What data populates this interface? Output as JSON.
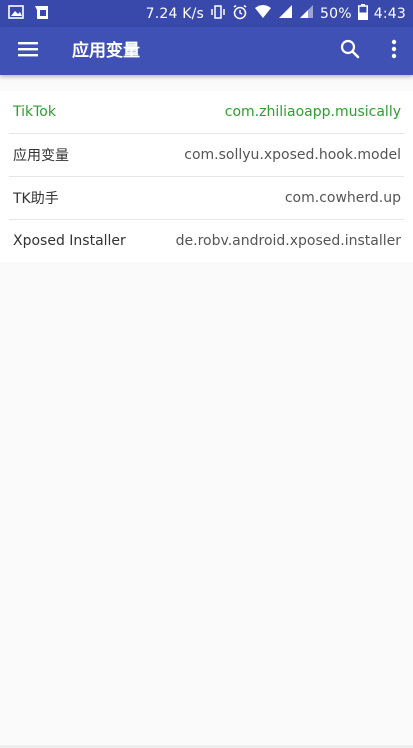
{
  "status_bar": {
    "left_icons": [
      "image-icon",
      "app-notification-icon"
    ],
    "net_speed": "7.24 K/s",
    "battery": "50%",
    "time": "4:43",
    "right_icons": [
      "vibrate-icon",
      "alarm-icon",
      "wifi-icon",
      "signal-icon",
      "signal-icon",
      "battery-icon"
    ]
  },
  "app_bar": {
    "title": "应用变量",
    "icons": [
      "menu-icon",
      "search-icon",
      "more-vert-icon"
    ]
  },
  "apps": [
    {
      "name": "TikTok",
      "package": "com.zhiliaoapp.musically",
      "active": true
    },
    {
      "name": "应用变量",
      "package": "com.sollyu.xposed.hook.model",
      "active": false
    },
    {
      "name": "TK助手",
      "package": "com.cowherd.up",
      "active": false
    },
    {
      "name": "Xposed Installer",
      "package": "de.robv.android.xposed.installer",
      "active": false
    }
  ],
  "colors": {
    "app_bar": "#3f51b5",
    "status_bar": "#3949ab",
    "active_row": "#2ca02c",
    "background": "#fafafa"
  }
}
